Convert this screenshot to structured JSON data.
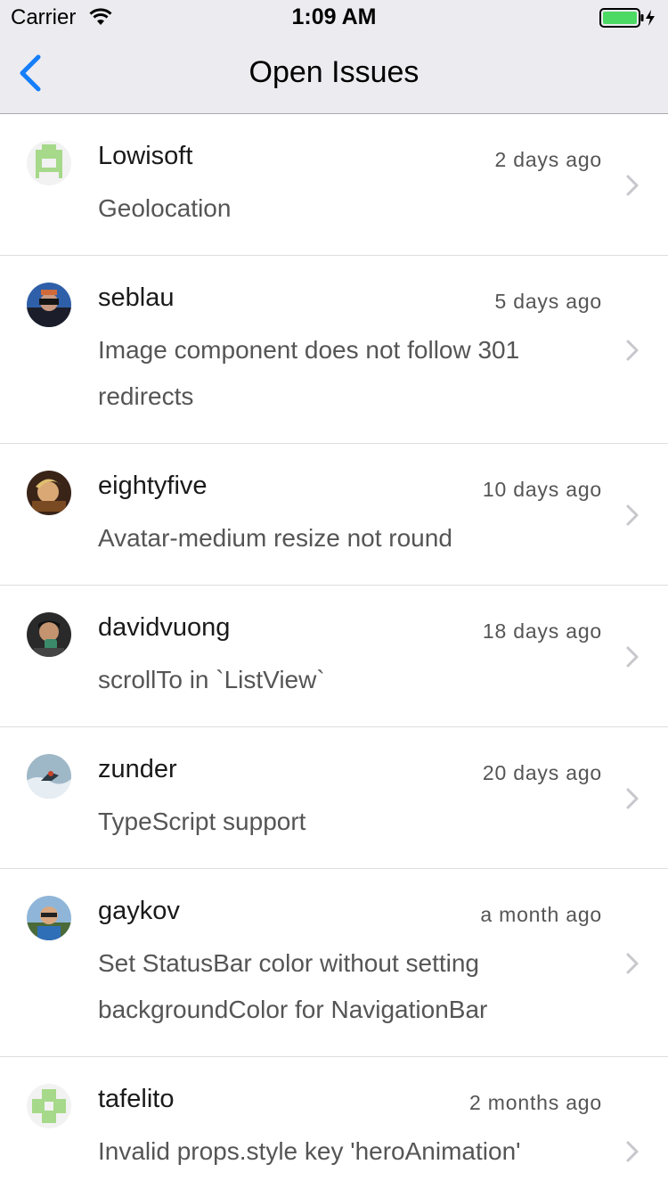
{
  "status_bar": {
    "carrier": "Carrier",
    "time": "1:09 AM"
  },
  "nav": {
    "title": "Open Issues",
    "back_icon": "chevron-left-icon"
  },
  "colors": {
    "accent": "#147efb",
    "battery": "#4cd964",
    "secondary_text": "#555555"
  },
  "issues": [
    {
      "author": "Lowisoft",
      "time": "2 days ago",
      "title": "Geolocation"
    },
    {
      "author": "seblau",
      "time": "5 days ago",
      "title": "Image component does not follow 301 redirects"
    },
    {
      "author": "eightyfive",
      "time": "10 days ago",
      "title": "Avatar-medium resize not round"
    },
    {
      "author": "davidvuong",
      "time": "18 days ago",
      "title": "scrollTo in `ListView`"
    },
    {
      "author": "zunder",
      "time": "20 days ago",
      "title": "TypeScript support"
    },
    {
      "author": "gaykov",
      "time": "a month ago",
      "title": "Set StatusBar color without setting backgroundColor for NavigationBar"
    },
    {
      "author": "tafelito",
      "time": "2 months ago",
      "title": "Invalid props.style key 'heroAnimation'"
    }
  ]
}
